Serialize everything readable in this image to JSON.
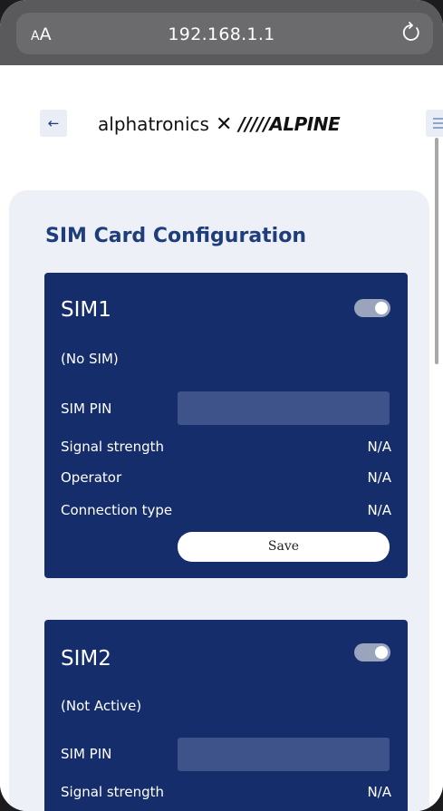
{
  "browser": {
    "text_size_label_small": "A",
    "text_size_label_large": "A",
    "url": "192.168.1.1"
  },
  "header": {
    "back_label": "←",
    "logo_alpha": "alphatronics",
    "logo_x": "✕",
    "logo_alpine": "/////ALPINE"
  },
  "page_title": "SIM Card Configuration",
  "sim1": {
    "title": "SIM1",
    "enabled": true,
    "status": "(No SIM)",
    "pin_label": "SIM PIN",
    "pin_value": "",
    "rows": [
      {
        "label": "Signal strength",
        "value": "N/A"
      },
      {
        "label": "Operator",
        "value": "N/A"
      },
      {
        "label": "Connection type",
        "value": "N/A"
      }
    ],
    "save_label": "Save"
  },
  "sim2": {
    "title": "SIM2",
    "enabled": true,
    "status": "(Not Active)",
    "pin_label": "SIM PIN",
    "pin_value": "",
    "rows": [
      {
        "label": "Signal strength",
        "value": "N/A"
      }
    ]
  },
  "colors": {
    "accent": "#1e3d7a",
    "card_bg": "#152d6b",
    "panel_bg": "#edf1f7"
  }
}
